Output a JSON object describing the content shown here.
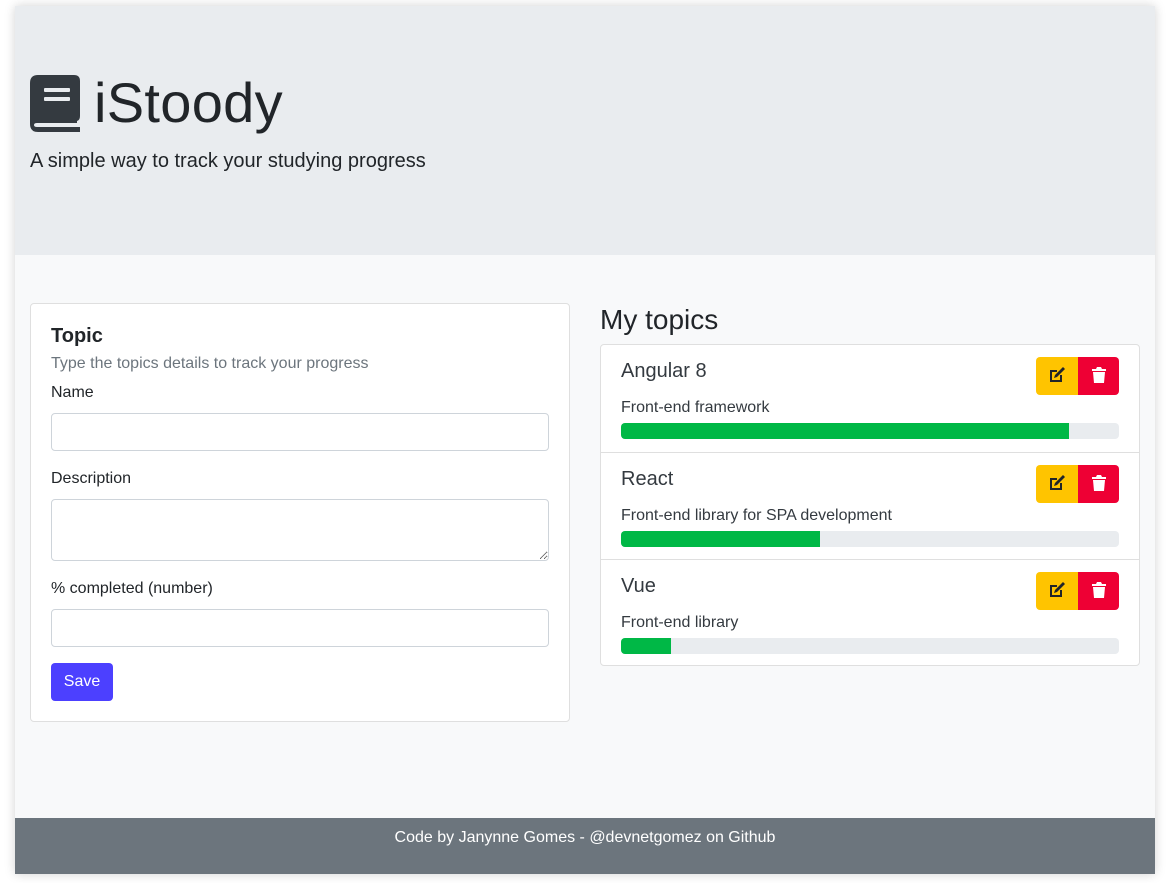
{
  "header": {
    "title": "iStoody",
    "subtitle": "A simple way to track your studying progress",
    "logo_icon": "book-icon"
  },
  "form": {
    "title": "Topic",
    "subtitle": "Type the topics details to track your progress",
    "name_label": "Name",
    "name_value": "",
    "description_label": "Description",
    "description_value": "",
    "percent_label": "% completed (number)",
    "percent_value": "",
    "save_label": "Save"
  },
  "topics": {
    "heading": "My topics",
    "items": [
      {
        "name": "Angular 8",
        "description": "Front-end framework",
        "progress_percent": 90
      },
      {
        "name": "React",
        "description": "Front-end library for SPA development",
        "progress_percent": 40
      },
      {
        "name": "Vue",
        "description": "Front-end library",
        "progress_percent": 10
      }
    ],
    "edit_icon": "edit-icon",
    "delete_icon": "trash-icon"
  },
  "footer": {
    "text": "Code by Janynne Gomes - @devnetgomez on Github"
  },
  "colors": {
    "primary": "#4c40ff",
    "warning": "#ffc400",
    "danger": "#ee0034",
    "success": "#00b846",
    "footer_bg": "#6c757d",
    "jumbotron_bg": "#e9ecef"
  }
}
